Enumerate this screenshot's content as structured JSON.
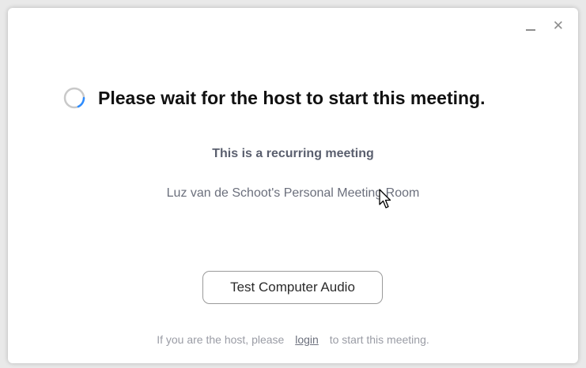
{
  "window": {
    "controls": {
      "minimize_icon": "minimize-icon",
      "close_icon": "close-icon"
    }
  },
  "main": {
    "heading": "Please wait for the host to start this meeting.",
    "spinner_icon": "loading-spinner-icon",
    "recurring_text": "This is a recurring meeting",
    "meeting_room": "Luz van de Schoot's Personal Meeting Room"
  },
  "actions": {
    "test_audio_label": "Test Computer Audio"
  },
  "footer": {
    "prefix": "If you are the host, please",
    "login_link": "login",
    "suffix": "to start this meeting."
  },
  "colors": {
    "spinner_track": "#c9c9c9",
    "spinner_arc": "#2d8cff",
    "heading": "#111111",
    "subtext": "#5a5f6e"
  }
}
